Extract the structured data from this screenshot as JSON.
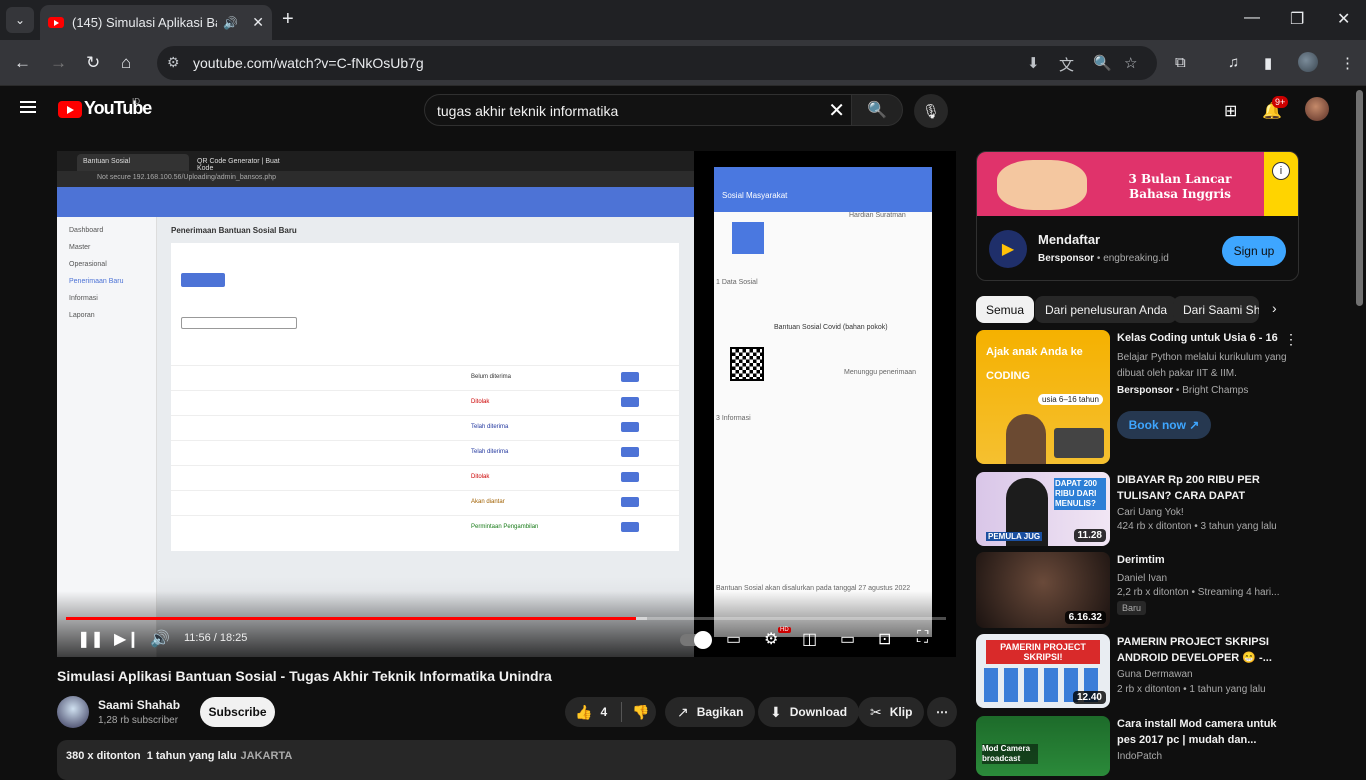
{
  "browser": {
    "tab_title": "(145) Simulasi Aplikasi Bant",
    "url": "youtube.com/watch?v=C-fNkOsUb7g"
  },
  "header": {
    "logo_text": "YouTube",
    "region": "ID",
    "search_query": "tugas akhir teknik informatika",
    "notification_count": "9+"
  },
  "player": {
    "current_time": "11:56",
    "duration": "18:25",
    "time_display": "11:56 / 18:25",
    "progress_fraction": 0.648,
    "buffer_fraction": 0.66,
    "hd_badge": "HD",
    "inner_browser": {
      "tab1": "Bantuan Sosial",
      "tab2": "QR Code Generator | Buat Kode",
      "addr": "Not secure   192.168.100.56/Uploading/admin_bansos.php",
      "page_heading": "Penerimaan Bantuan Sosial Baru",
      "sidebar": [
        "Dashboard",
        "Master",
        "Operasional",
        "Penerimaan Baru",
        "Informasi",
        "Laporan"
      ],
      "status_rows": [
        "Belum diterima",
        "Ditolak",
        "Telah diterima",
        "Telah diterima",
        "Ditolak",
        "Akan diantar",
        "Permintaan Pengambilan"
      ]
    },
    "phone": {
      "app_title": "Sosial Masyarakat",
      "name": "Hardian Suratman",
      "status": "Menunggu penerimaan",
      "section": "1 Data Sosial",
      "program": "Bantuan Sosial Covid (bahan pokok)",
      "info_header": "3 Informasi",
      "date_note": "Bantuan Sosial akan disalurkan pada tanggal 27 agustus 2022"
    }
  },
  "video": {
    "title": "Simulasi Aplikasi Bantuan Sosial - Tugas Akhir Teknik Informatika Unindra",
    "channel": "Saami Shahab",
    "subscribers": "1,28 rb subscriber",
    "subscribe_label": "Subscribe",
    "likes": "4",
    "share_label": "Bagikan",
    "download_label": "Download",
    "clip_label": "Klip",
    "views": "380 x ditonton",
    "uploaded": "1 tahun yang lalu",
    "location": "JAKARTA"
  },
  "ad": {
    "banner_text": "3 Bulan Lancar Bahasa Inggris",
    "title": "Mendaftar",
    "sponsored": "Bersponsor",
    "domain": "engbreaking.id",
    "cta": "Sign up"
  },
  "chips": [
    "Semua",
    "Dari penelusuran Anda",
    "Dari Saami Sh"
  ],
  "recommendations": [
    {
      "title": "Kelas Coding untuk Usia 6 - 16",
      "desc": "Belajar Python melalui kurikulum yang dibuat oleh pakar IIT & IIM.",
      "sponsored": "Bersponsor",
      "channel": "Bright Champs",
      "cta": "Book now",
      "thumb_text": "Ajak anak Anda ke CODING",
      "thumb_sub": "usia 6–16 tahun"
    },
    {
      "title": "DIBAYAR Rp 200 RIBU PER TULISAN? CARA DAPAT UANG...",
      "channel": "Cari Uang Yok!",
      "meta": "424 rb x ditonton • 3 tahun yang lalu",
      "duration": "11.28",
      "thumb_text": "DAPAT 200 RIBU DARI MENULIS?",
      "thumb_sub": "PEMULA JUG"
    },
    {
      "title": "Derimtim",
      "channel": "Daniel Ivan",
      "meta": "2,2 rb x ditonton • Streaming 4 hari...",
      "badge": "Baru",
      "duration": "6.16.32"
    },
    {
      "title": "PAMERIN PROJECT SKRIPSI ANDROID DEVELOPER 😁 -...",
      "channel": "Guna Dermawan",
      "meta": "2 rb x ditonton • 1 tahun yang lalu",
      "duration": "12.40",
      "thumb_text": "PAMERIN PROJECT SKRIPSI!"
    },
    {
      "title": "Cara install Mod camera untuk pes 2017 pc | mudah dan...",
      "channel": "IndoPatch",
      "thumb_text": "Mod Camera broadcast"
    }
  ]
}
